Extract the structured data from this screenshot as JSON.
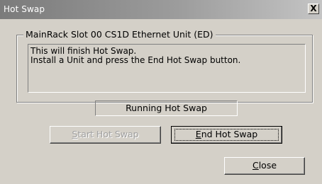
{
  "window": {
    "title": "Hot Swap",
    "close_glyph": "X"
  },
  "group": {
    "legend": "MainRack Slot 00 CS1D Ethernet Unit (ED)"
  },
  "message": {
    "line1": "This will finish Hot Swap.",
    "line2": "Install a Unit and press the End Hot Swap button."
  },
  "status": {
    "text": "Running Hot Swap"
  },
  "buttons": {
    "start": {
      "mnemonic": "S",
      "rest": "tart Hot Swap",
      "enabled": false
    },
    "end": {
      "mnemonic": "E",
      "rest": "nd Hot Swap",
      "enabled": true
    },
    "close": {
      "mnemonic": "C",
      "rest": "lose",
      "enabled": true
    }
  }
}
